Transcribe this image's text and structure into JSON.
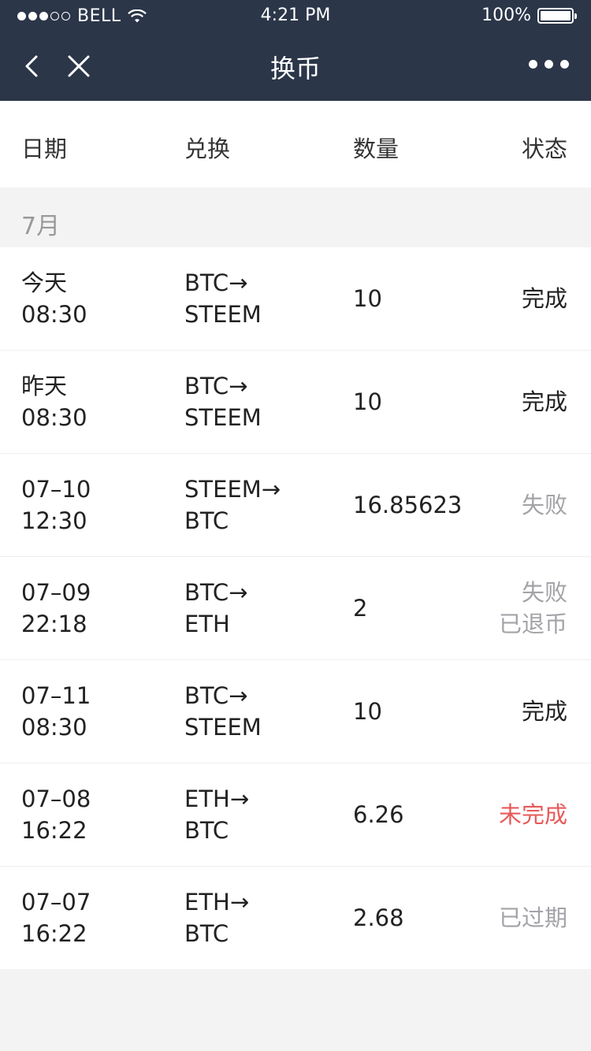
{
  "status_bar": {
    "carrier": "BELL",
    "time": "4:21 PM",
    "battery": "100%"
  },
  "nav": {
    "title": "换币",
    "icons": [
      "back-icon",
      "close-icon",
      "more-icon"
    ]
  },
  "table_header": {
    "date": "日期",
    "pair": "兑换",
    "qty": "数量",
    "status": "状态"
  },
  "month_label": "7月",
  "rows": [
    {
      "date": "今天",
      "time": "08:30",
      "from": "BTC→",
      "to": "STEEM",
      "qty": "10",
      "status": [
        "完成"
      ],
      "status_kind": "done"
    },
    {
      "date": "昨天",
      "time": "08:30",
      "from": "BTC→",
      "to": "STEEM",
      "qty": "10",
      "status": [
        "完成"
      ],
      "status_kind": "done"
    },
    {
      "date": "07–10",
      "time": "12:30",
      "from": "STEEM→",
      "to": "BTC",
      "qty": "16.85623",
      "status": [
        "失败"
      ],
      "status_kind": "fail"
    },
    {
      "date": "07–09",
      "time": "22:18",
      "from": "BTC→",
      "to": "ETH",
      "qty": "2",
      "status": [
        "失败",
        "已退币"
      ],
      "status_kind": "fail"
    },
    {
      "date": "07–11",
      "time": "08:30",
      "from": "BTC→",
      "to": "STEEM",
      "qty": "10",
      "status": [
        "完成"
      ],
      "status_kind": "done"
    },
    {
      "date": "07–08",
      "time": "16:22",
      "from": "ETH→",
      "to": "BTC",
      "qty": "6.26",
      "status": [
        "未完成"
      ],
      "status_kind": "pending"
    },
    {
      "date": "07–07",
      "time": "16:22",
      "from": "ETH→",
      "to": "BTC",
      "qty": "2.68",
      "status": [
        "已过期"
      ],
      "status_kind": "expired"
    }
  ],
  "colors": {
    "header_bg": "#2b3649",
    "pending": "#e85a5a",
    "muted": "#a3a3a8"
  }
}
